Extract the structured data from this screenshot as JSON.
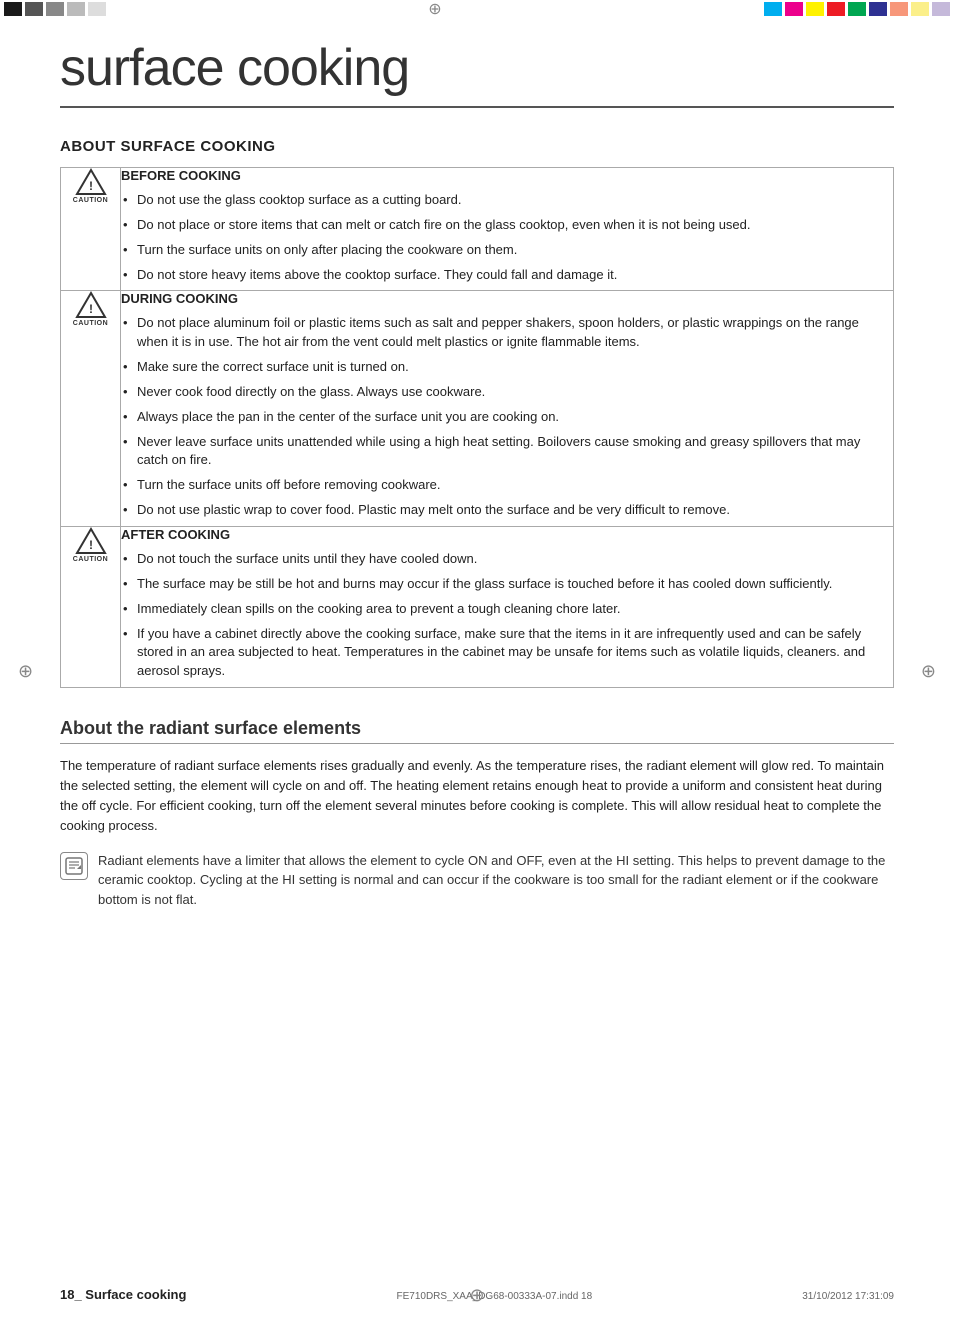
{
  "page": {
    "title": "surface cooking",
    "top_bar": {
      "left_swatches": [
        "black",
        "dk-gray",
        "md-gray",
        "lt-gray",
        "lighter-gray"
      ],
      "right_swatches": [
        "cyan",
        "magenta",
        "yellow",
        "red",
        "green",
        "blue",
        "pink",
        "lt-yellow",
        "lt-purple"
      ]
    }
  },
  "about_surface_cooking": {
    "heading": "ABOUT SURFACE COOKING",
    "before_cooking": {
      "icon_label": "CAUTION",
      "title": "BEFORE COOKING",
      "bullets": [
        "Do not use the glass cooktop surface as a cutting board.",
        "Do not place or store items that can melt or catch fire on the glass cooktop, even when it is not being used.",
        "Turn the surface units on only after placing the cookware on them.",
        "Do not store heavy items above the cooktop surface. They could fall and damage it."
      ]
    },
    "during_cooking": {
      "icon_label": "CAUTION",
      "title": "DURING COOKING",
      "bullets": [
        "Do not place aluminum foil or plastic items such as salt and pepper shakers, spoon holders, or plastic wrappings on the range when it is in use. The hot air from the vent could melt plastics or ignite flammable items.",
        "Make sure the correct surface unit is turned on.",
        "Never cook food directly on the glass. Always use cookware.",
        "Always place the pan in the center of the surface unit you are cooking on.",
        "Never leave surface units unattended while using a high heat setting. Boilovers cause smoking and greasy spillovers that may catch on fire.",
        "Turn the surface units off before removing cookware.",
        "Do not use plastic wrap to cover food. Plastic may melt onto the surface and be very difficult to remove."
      ]
    },
    "after_cooking": {
      "icon_label": "CAUTION",
      "title": "AFTER COOKING",
      "bullets": [
        "Do not touch the surface units until they have cooled down.",
        "The surface may be still be hot and burns may occur if the glass surface is touched before it has cooled down sufficiently.",
        "Immediately clean spills on the cooking area to prevent a tough cleaning chore later.",
        "If you have a cabinet directly above the cooking surface, make sure that the items in it are infrequently used and can be safely stored in an area subjected to heat. Temperatures in the cabinet may be unsafe for items such as volatile liquids, cleaners. and aerosol sprays."
      ]
    }
  },
  "radiant_section": {
    "heading": "About the radiant surface elements",
    "body_text": "The temperature of radiant surface elements rises gradually and evenly. As the temperature rises, the radiant element will glow red. To maintain the selected setting, the element will cycle on and off. The heating element retains enough heat to provide a uniform and consistent heat during the off cycle. For efficient cooking, turn off the element several minutes before cooking is complete. This will allow residual heat to complete the cooking process.",
    "note_text": "Radiant elements have a limiter that allows the element to cycle ON and OFF, even at the HI setting. This helps to prevent damage to the ceramic cooktop. Cycling at the HI setting is normal and can occur if the cookware is too small for the radiant element or if the cookware bottom is not flat."
  },
  "footer": {
    "page_number": "18_ Surface cooking",
    "filename": "FE710DRS_XAA_DG68-00333A-07.indd   18",
    "date": "31/10/2012   17:31:09"
  }
}
